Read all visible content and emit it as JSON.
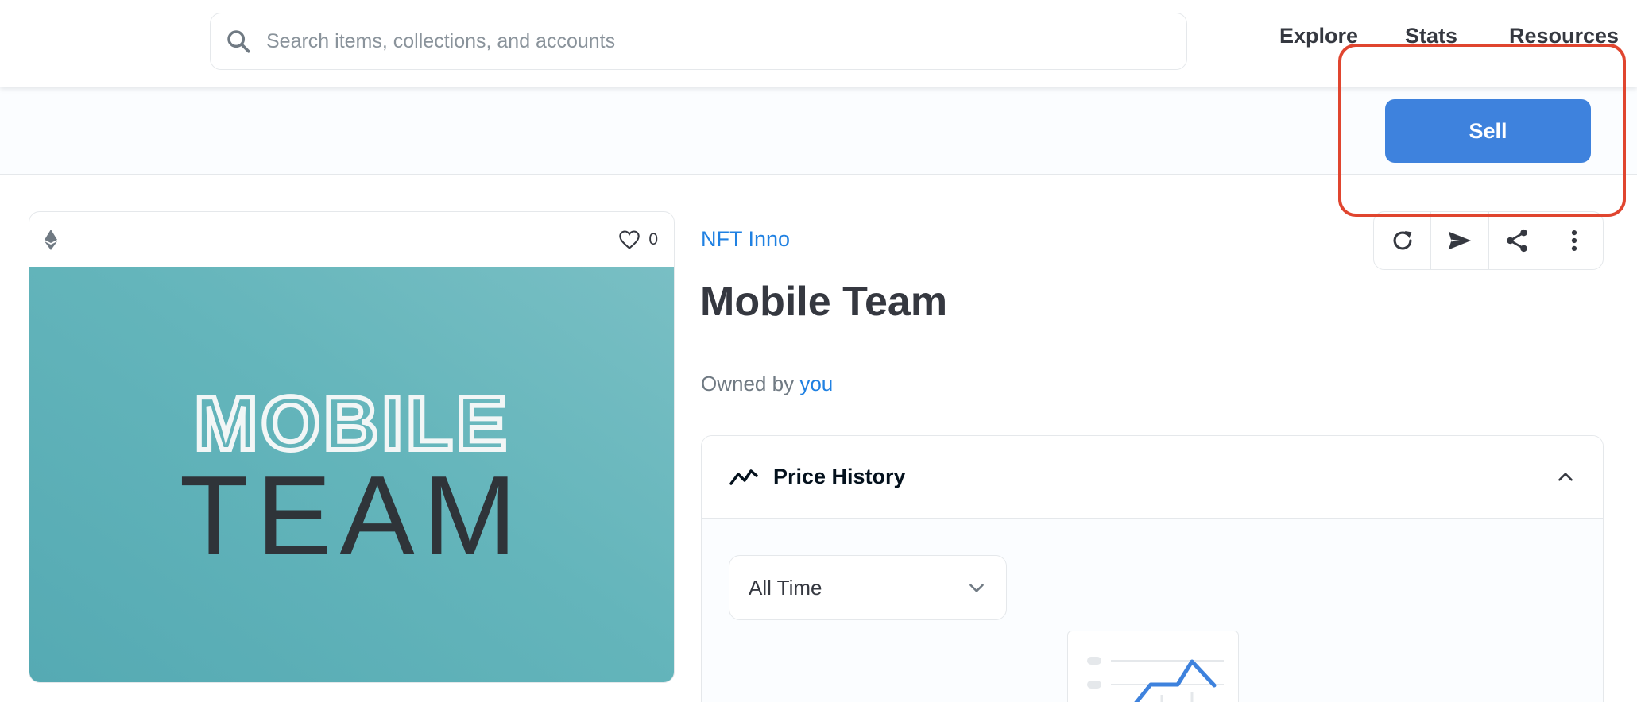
{
  "header": {
    "search_placeholder": "Search items, collections, and accounts",
    "nav": [
      "Explore",
      "Stats",
      "Resources"
    ]
  },
  "toolbar": {
    "sell_label": "Sell"
  },
  "item": {
    "likes": "0",
    "collection": "NFT Inno",
    "title": "Mobile Team",
    "owned_by_prefix": "Owned by",
    "owner": "you",
    "image_text": [
      "MOBILE",
      "TEAM"
    ]
  },
  "price_history": {
    "title": "Price History",
    "range_selected": "All Time"
  },
  "colors": {
    "accent": "#2081e2",
    "sell_button": "#3e82dd",
    "highlight": "#e0452f",
    "image_bg": "#64b5bb"
  },
  "icons": [
    "search-icon",
    "ethereum-icon",
    "heart-icon",
    "refresh-icon",
    "send-icon",
    "share-icon",
    "more-icon",
    "chart-line-icon",
    "chevron-up-icon",
    "chevron-down-icon"
  ]
}
